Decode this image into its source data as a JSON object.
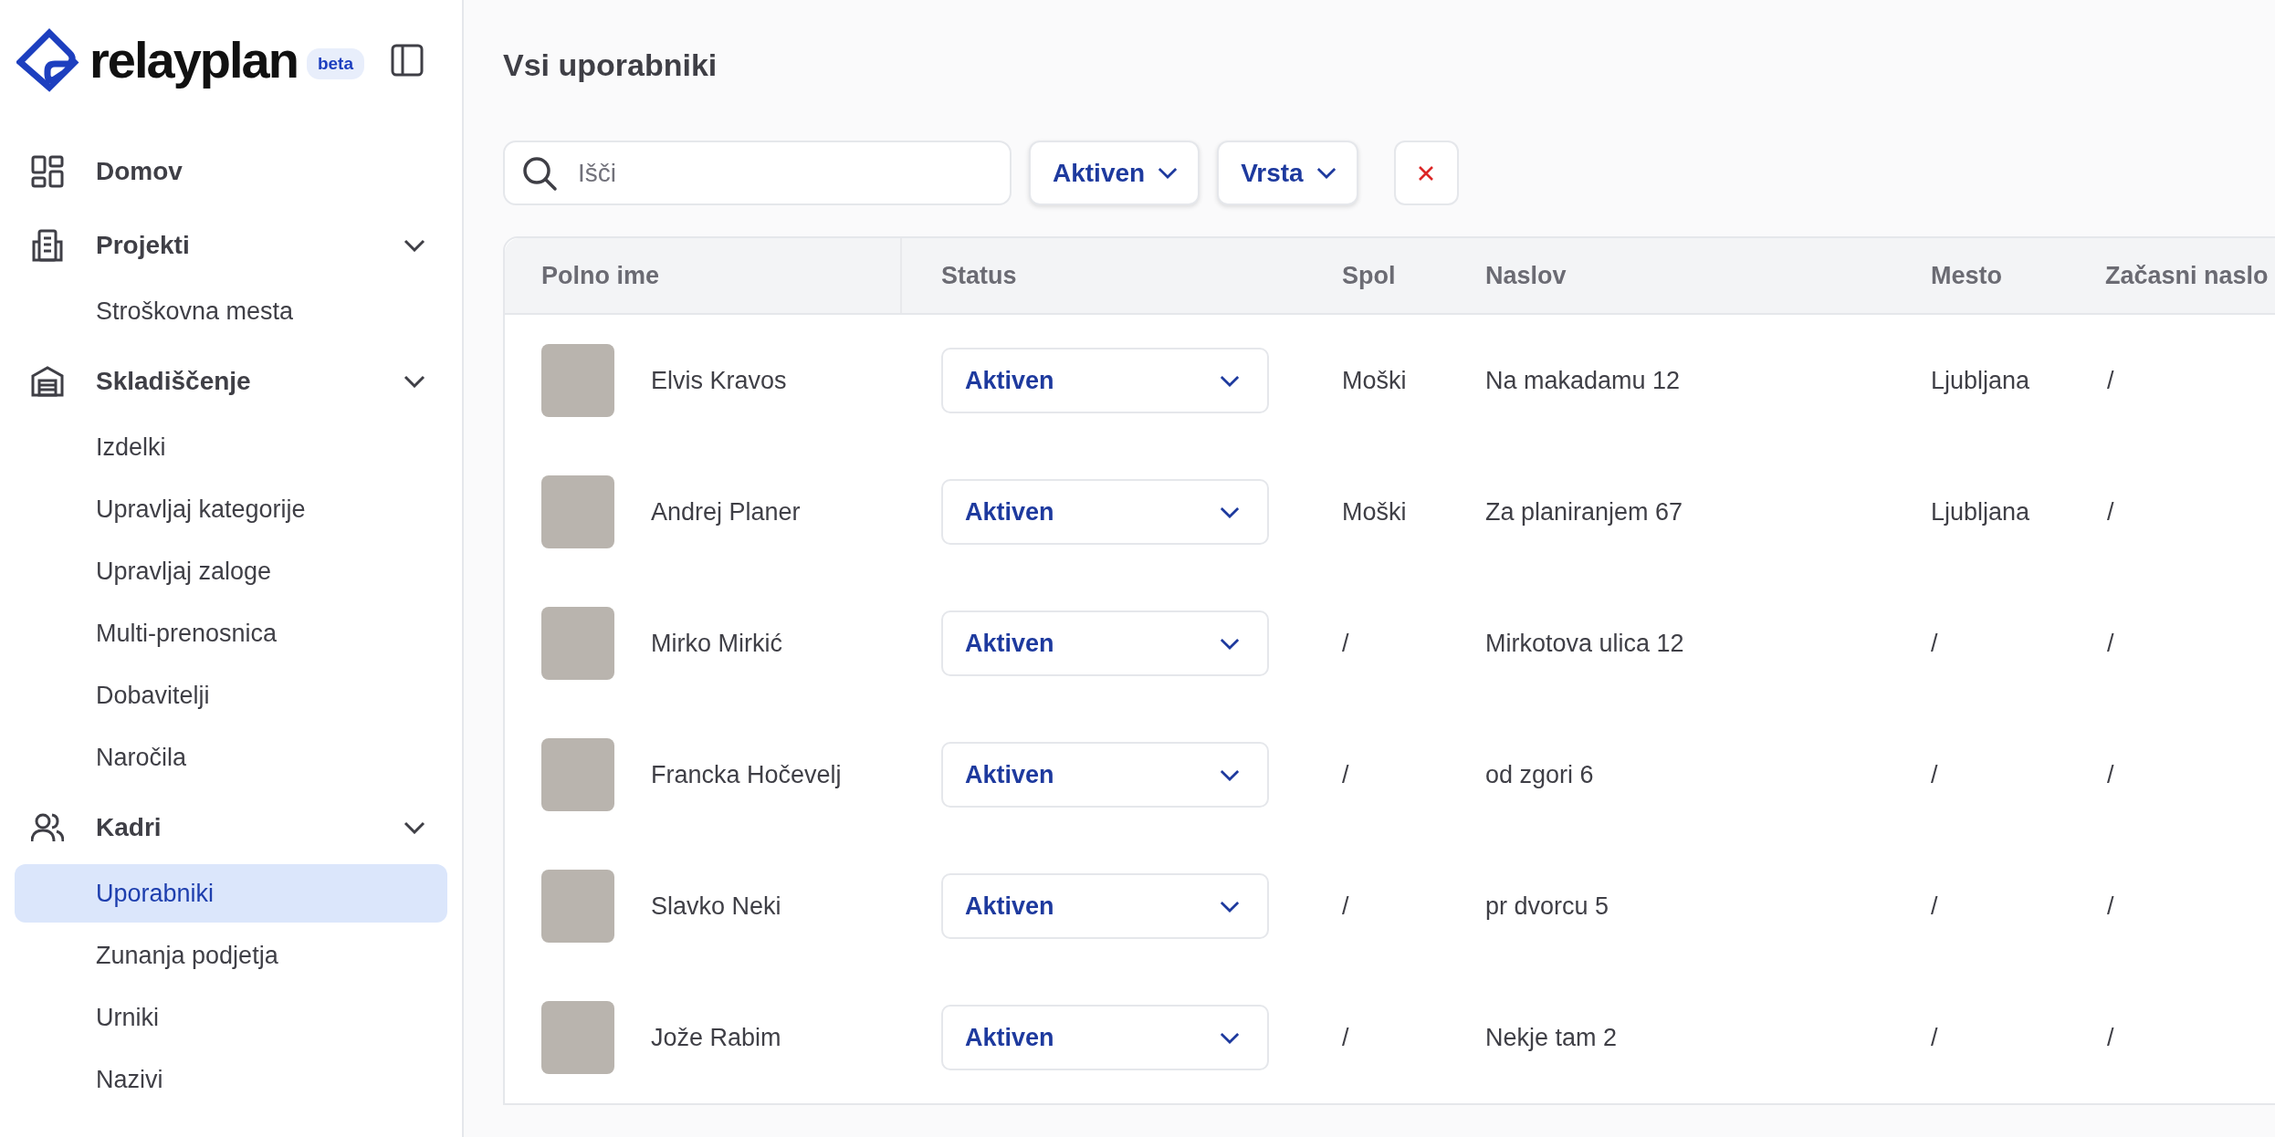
{
  "logo": {
    "name": "relayplan",
    "badge": "beta"
  },
  "sidebar": {
    "items": [
      {
        "label": "Domov",
        "kind": "link",
        "selected": false
      },
      {
        "label": "Projekti",
        "kind": "group",
        "expanded": true,
        "children": [
          {
            "label": "Stroškovna mesta",
            "selected": false
          }
        ]
      },
      {
        "label": "Skladiščenje",
        "kind": "group",
        "expanded": true,
        "children": [
          {
            "label": "Izdelki",
            "selected": false
          },
          {
            "label": "Upravljaj kategorije",
            "selected": false
          },
          {
            "label": "Upravljaj zaloge",
            "selected": false
          },
          {
            "label": "Multi-prenosnica",
            "selected": false
          },
          {
            "label": "Dobavitelji",
            "selected": false
          },
          {
            "label": "Naročila",
            "selected": false
          }
        ]
      },
      {
        "label": "Kadri",
        "kind": "group",
        "expanded": true,
        "children": [
          {
            "label": "Uporabniki",
            "selected": true
          },
          {
            "label": "Zunanja podjetja",
            "selected": false
          },
          {
            "label": "Urniki",
            "selected": false
          },
          {
            "label": "Nazivi",
            "selected": false
          }
        ]
      }
    ]
  },
  "page": {
    "title": "Vsi uporabniki"
  },
  "search": {
    "placeholder": "Išči"
  },
  "filters": [
    {
      "label": "Aktiven"
    },
    {
      "label": "Vrsta"
    }
  ],
  "table": {
    "columns": [
      "Polno ime",
      "Status",
      "Spol",
      "Naslov",
      "Mesto",
      "Začasni naslo"
    ],
    "rows": [
      {
        "name": "Elvis Kravos",
        "status": "Aktiven",
        "gender": "Moški",
        "address": "Na makadamu 12",
        "city": "Ljubljana",
        "temp_address": "/"
      },
      {
        "name": "Andrej Planer",
        "status": "Aktiven",
        "gender": "Moški",
        "address": "Za planiranjem 67",
        "city": "Ljubljana",
        "temp_address": "/"
      },
      {
        "name": "Mirko Mirkić",
        "status": "Aktiven",
        "gender": "/",
        "address": "Mirkotova ulica 12",
        "city": "/",
        "temp_address": "/"
      },
      {
        "name": "Francka Hočevelj",
        "status": "Aktiven",
        "gender": "/",
        "address": "od zgori 6",
        "city": "/",
        "temp_address": "/"
      },
      {
        "name": "Slavko Neki",
        "status": "Aktiven",
        "gender": "/",
        "address": "pr dvorcu 5",
        "city": "/",
        "temp_address": "/"
      },
      {
        "name": "Jože Rabim",
        "status": "Aktiven",
        "gender": "/",
        "address": "Nekje tam 2",
        "city": "/",
        "temp_address": "/"
      }
    ]
  }
}
